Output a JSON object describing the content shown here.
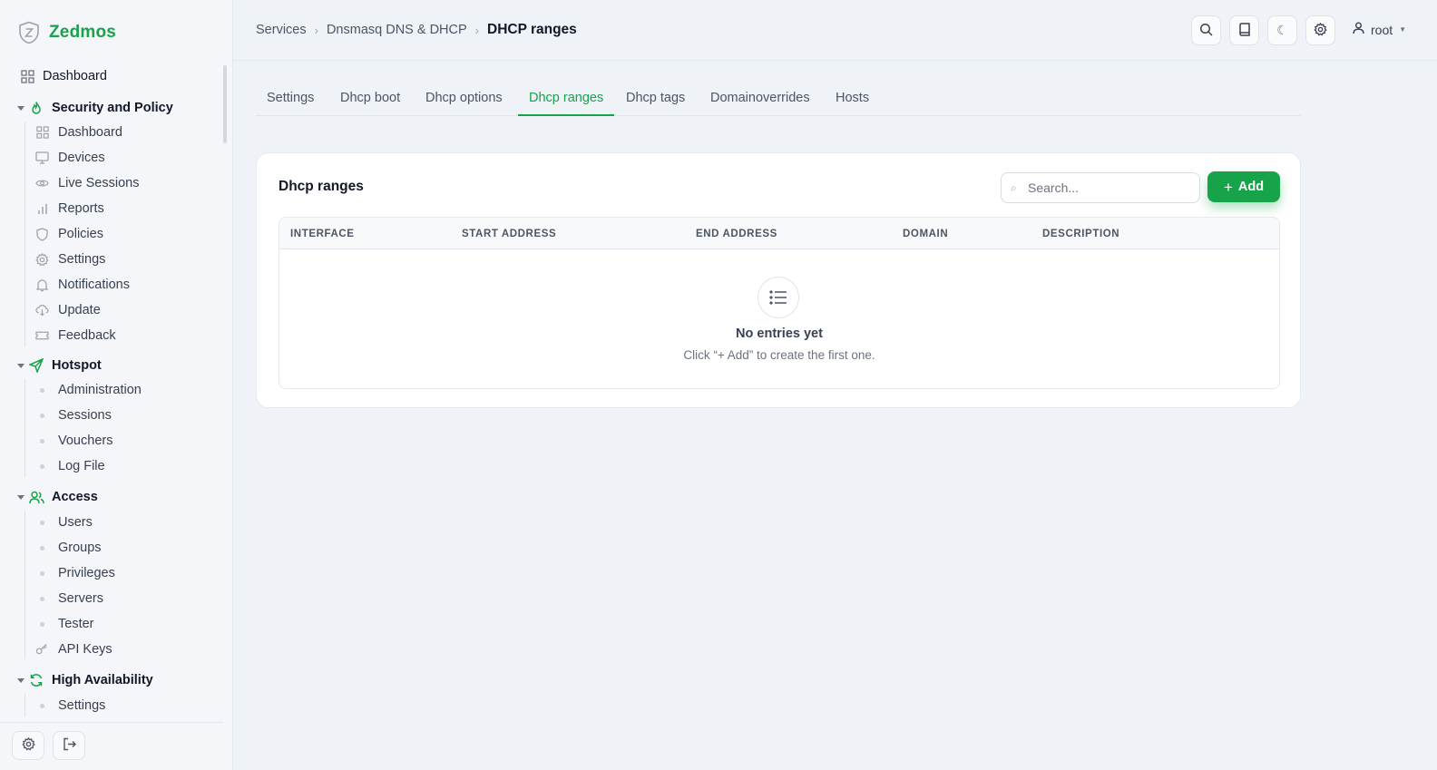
{
  "brand": {
    "name": "Zedmos"
  },
  "colors": {
    "accent": "#16a34a",
    "background": "#eff2f7",
    "card": "#ffffff"
  },
  "sidebar": {
    "top_item": {
      "label": "Dashboard",
      "icon": "grid-icon"
    },
    "groups": [
      {
        "label": "Security and Policy",
        "icon": "flame-icon",
        "items": [
          {
            "label": "Dashboard",
            "icon": "grid-icon"
          },
          {
            "label": "Devices",
            "icon": "monitor-icon"
          },
          {
            "label": "Live Sessions",
            "icon": "eye-icon"
          },
          {
            "label": "Reports",
            "icon": "bar-chart-icon"
          },
          {
            "label": "Policies",
            "icon": "shield-icon"
          },
          {
            "label": "Settings",
            "icon": "gear-icon"
          },
          {
            "label": "Notifications",
            "icon": "bell-icon"
          },
          {
            "label": "Update",
            "icon": "cloud-download-icon"
          },
          {
            "label": "Feedback",
            "icon": "ticket-icon"
          }
        ]
      },
      {
        "label": "Hotspot",
        "icon": "send-icon",
        "items": [
          {
            "label": "Administration"
          },
          {
            "label": "Sessions"
          },
          {
            "label": "Vouchers"
          },
          {
            "label": "Log File"
          }
        ]
      },
      {
        "label": "Access",
        "icon": "users-icon",
        "items": [
          {
            "label": "Users"
          },
          {
            "label": "Groups"
          },
          {
            "label": "Privileges"
          },
          {
            "label": "Servers"
          },
          {
            "label": "Tester"
          },
          {
            "label": "API Keys",
            "icon": "key-icon"
          }
        ]
      },
      {
        "label": "High Availability",
        "icon": "refresh-icon",
        "items": [
          {
            "label": "Settings"
          }
        ]
      }
    ],
    "footer": {
      "settings_icon": "gear-icon",
      "logout_icon": "logout-icon"
    }
  },
  "header": {
    "breadcrumbs": [
      "Services",
      "Dnsmasq DNS & DHCP",
      "DHCP ranges"
    ],
    "buttons": [
      "search-icon",
      "book-icon",
      "moon-icon",
      "gear-icon"
    ],
    "user": {
      "name": "root",
      "icon": "user-icon"
    }
  },
  "tabs": [
    {
      "label": "Settings",
      "active": false
    },
    {
      "label": "Dhcp boot",
      "active": false
    },
    {
      "label": "Dhcp options",
      "active": false
    },
    {
      "label": "Dhcp ranges",
      "active": true
    },
    {
      "label": "Dhcp tags",
      "active": false
    },
    {
      "label": "Domainoverrides",
      "active": false
    },
    {
      "label": "Hosts",
      "active": false
    }
  ],
  "card": {
    "title": "Dhcp ranges",
    "search_placeholder": "Search...",
    "add_label": "Add",
    "columns": [
      "INTERFACE",
      "START ADDRESS",
      "END ADDRESS",
      "DOMAIN",
      "DESCRIPTION"
    ],
    "rows": [],
    "empty": {
      "title": "No entries yet",
      "subtitle": "Click “+ Add” to create the first one."
    }
  }
}
